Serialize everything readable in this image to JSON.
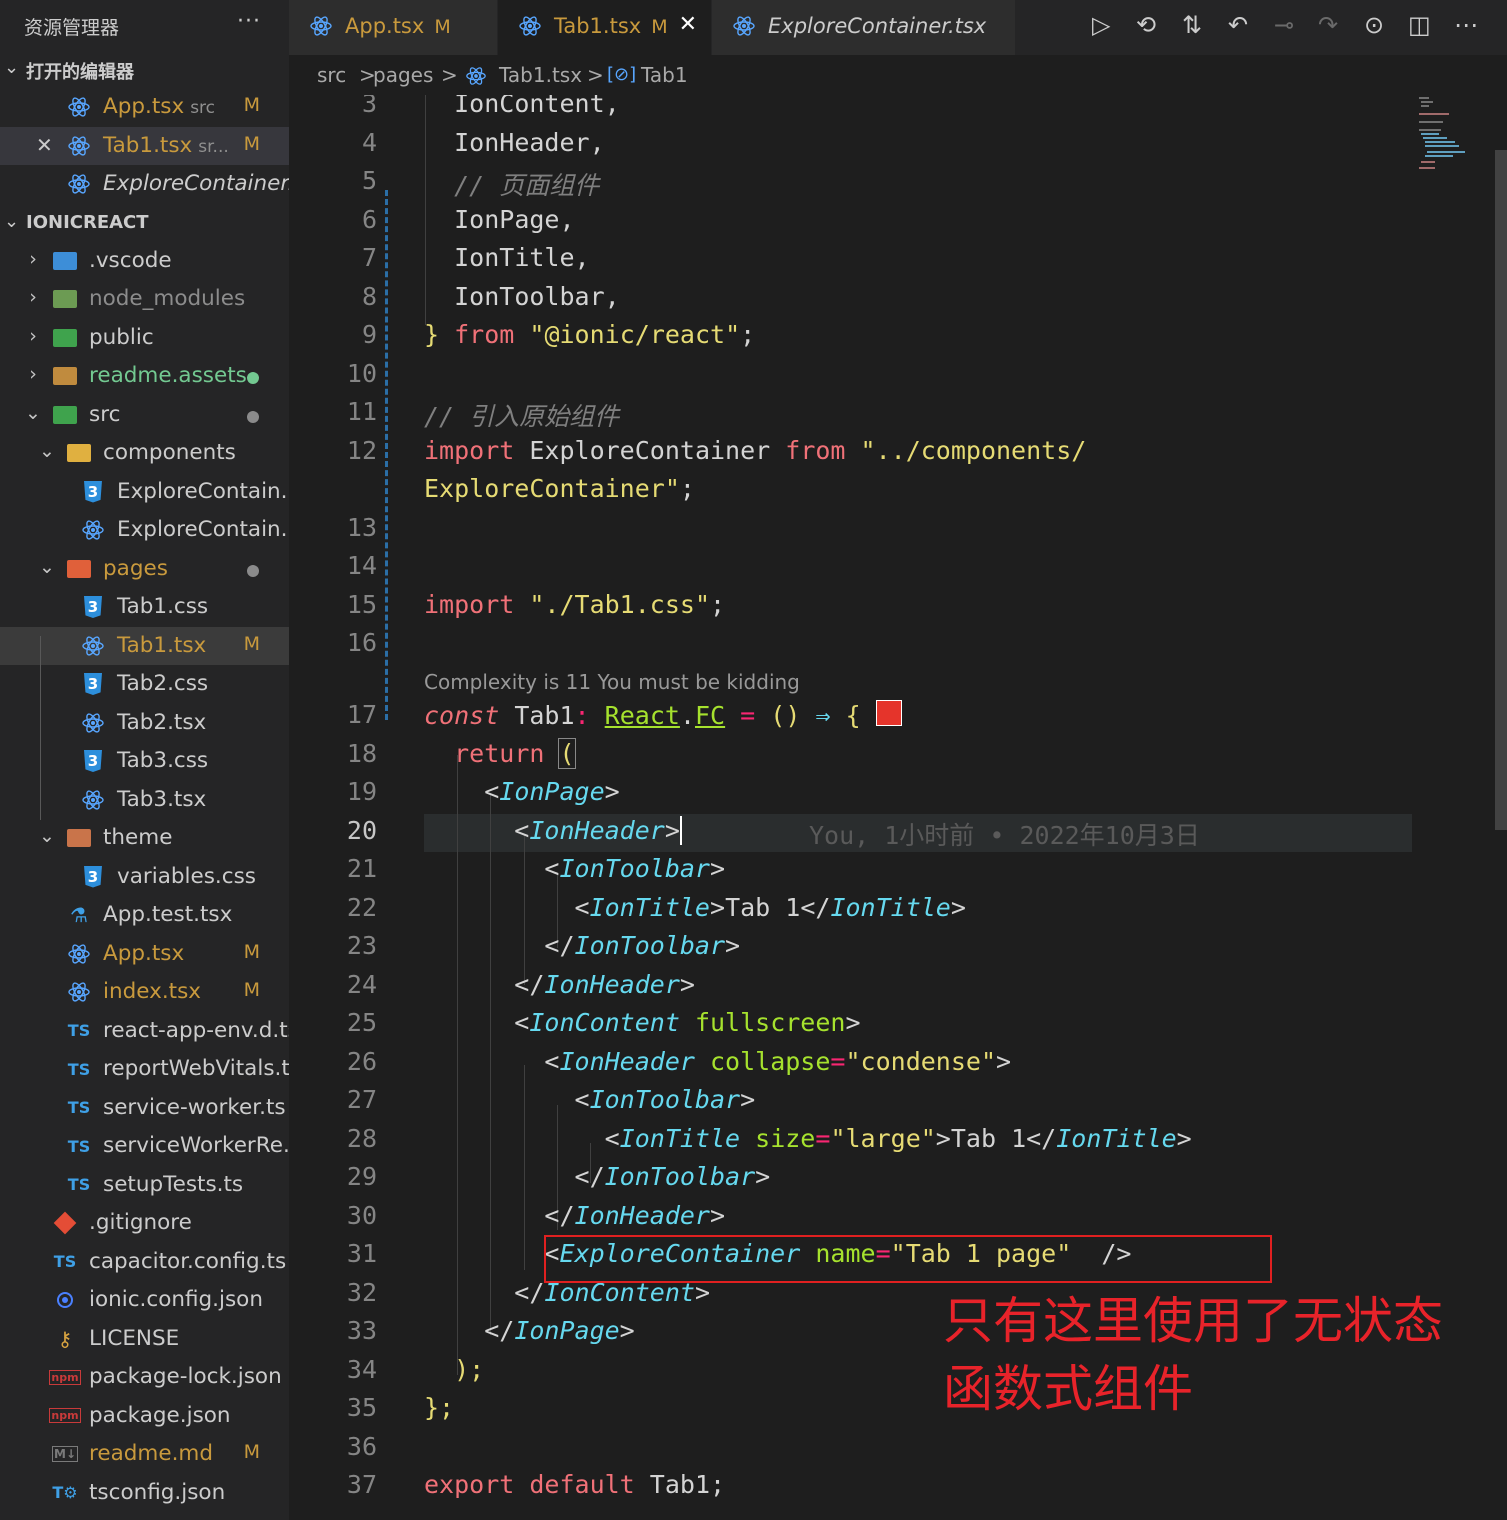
{
  "sidebar": {
    "title": "资源管理器",
    "more": "···",
    "open_editors": {
      "label": "打开的编辑器",
      "items": [
        {
          "name": "App.tsx",
          "sub": "src",
          "badge": "M"
        },
        {
          "name": "Tab1.tsx",
          "sub": "sr...",
          "badge": "M"
        },
        {
          "name": "ExploreContainer...",
          "sub": "",
          "badge": ""
        }
      ]
    },
    "project": {
      "label": "IONICREACT",
      "items": [
        {
          "name": ".vscode",
          "badge": ""
        },
        {
          "name": "node_modules",
          "badge": ""
        },
        {
          "name": "public",
          "badge": ""
        },
        {
          "name": "readme.assets",
          "badge": ""
        },
        {
          "name": "src",
          "badge": ""
        },
        {
          "name": "components",
          "badge": ""
        },
        {
          "name": "ExploreContain...",
          "badge": ""
        },
        {
          "name": "ExploreContain...",
          "badge": ""
        },
        {
          "name": "pages",
          "badge": ""
        },
        {
          "name": "Tab1.css",
          "badge": ""
        },
        {
          "name": "Tab1.tsx",
          "badge": "M"
        },
        {
          "name": "Tab2.css",
          "badge": ""
        },
        {
          "name": "Tab2.tsx",
          "badge": ""
        },
        {
          "name": "Tab3.css",
          "badge": ""
        },
        {
          "name": "Tab3.tsx",
          "badge": ""
        },
        {
          "name": "theme",
          "badge": ""
        },
        {
          "name": "variables.css",
          "badge": ""
        },
        {
          "name": "App.test.tsx",
          "badge": ""
        },
        {
          "name": "App.tsx",
          "badge": "M"
        },
        {
          "name": "index.tsx",
          "badge": "M"
        },
        {
          "name": "react-app-env.d.ts",
          "badge": ""
        },
        {
          "name": "reportWebVitals.ts",
          "badge": ""
        },
        {
          "name": "service-worker.ts",
          "badge": ""
        },
        {
          "name": "serviceWorkerRe...",
          "badge": ""
        },
        {
          "name": "setupTests.ts",
          "badge": ""
        },
        {
          "name": ".gitignore",
          "badge": ""
        },
        {
          "name": "capacitor.config.ts",
          "badge": ""
        },
        {
          "name": "ionic.config.json",
          "badge": ""
        },
        {
          "name": "LICENSE",
          "badge": ""
        },
        {
          "name": "package-lock.json",
          "badge": ""
        },
        {
          "name": "package.json",
          "badge": ""
        },
        {
          "name": "readme.md",
          "badge": "M"
        },
        {
          "name": "tsconfig.json",
          "badge": ""
        }
      ]
    }
  },
  "tabs": [
    {
      "label": "App.tsx",
      "badge": "M"
    },
    {
      "label": "Tab1.tsx",
      "badge": "M"
    },
    {
      "label": "ExploreContainer.tsx",
      "badge": ""
    }
  ],
  "breadcrumb": [
    "src",
    ">",
    "pages",
    ">",
    "Tab1.tsx",
    ">",
    "Tab1"
  ],
  "editor": {
    "line_numbers": [
      "3",
      "4",
      "5",
      "6",
      "7",
      "8",
      "9",
      "10",
      "11",
      "12",
      "13",
      "14",
      "15",
      "16",
      "17",
      "18",
      "19",
      "20",
      "21",
      "22",
      "23",
      "24",
      "25",
      "26",
      "27",
      "28",
      "29",
      "30",
      "31",
      "32",
      "33",
      "34",
      "35",
      "36",
      "37"
    ],
    "codelens": "Complexity is 11 You must be kidding",
    "blame": "You, 1小时前 • 2022年10月3日",
    "tokens": {
      "l3": "IonContent,",
      "l4": "IonHeader,",
      "l5": "// 页面组件",
      "l6": "IonPage,",
      "l7": "IonTitle,",
      "l8": "IonToolbar,",
      "l9a": "}",
      "l9b": "from",
      "l9c": "\"@ionic/react\"",
      "l9d": ";",
      "l11": "// 引入原始组件",
      "l12a": "import",
      "l12b": "ExploreContainer",
      "l12c": "from",
      "l12d": "\"../components/",
      "l12e": "ExploreContainer\"",
      "l12f": ";",
      "l15a": "import",
      "l15b": "\"./Tab1.css\"",
      "l15c": ";",
      "l17a": "const",
      "l17b": "Tab1",
      "l17c": ":",
      "l17d": "React",
      "l17e": ".",
      "l17f": "FC",
      "l17g": "=",
      "l17h": "()",
      "l17i": "⇒",
      "l17j": "{",
      "l18a": "return",
      "l18b": "(",
      "tag_IonPage": "IonPage",
      "tag_IonHeader": "IonHeader",
      "tag_IonToolbar": "IonToolbar",
      "tag_IonTitle": "IonTitle",
      "tag_IonContent": "IonContent",
      "tag_ExploreContainer": "ExploreContainer",
      "attr_fullscreen": "fullscreen",
      "attr_collapse": "collapse",
      "attr_size": "size",
      "attr_name": "name",
      "val_condense": "\"condense\"",
      "val_large": "\"large\"",
      "val_tab1page": "\"Tab 1 page\"",
      "text_tab1": "Tab 1",
      "l34": ");",
      "l35": "};",
      "l37a": "export",
      "l37b": "default",
      "l37c": "Tab1;"
    }
  },
  "annotation": {
    "line1": "只有这里使用了无状态",
    "line2": "函数式组件"
  },
  "colors": {
    "accent_red": "#e8232a",
    "modified": "#c99a3d",
    "react_blue": "#58a6ff"
  }
}
